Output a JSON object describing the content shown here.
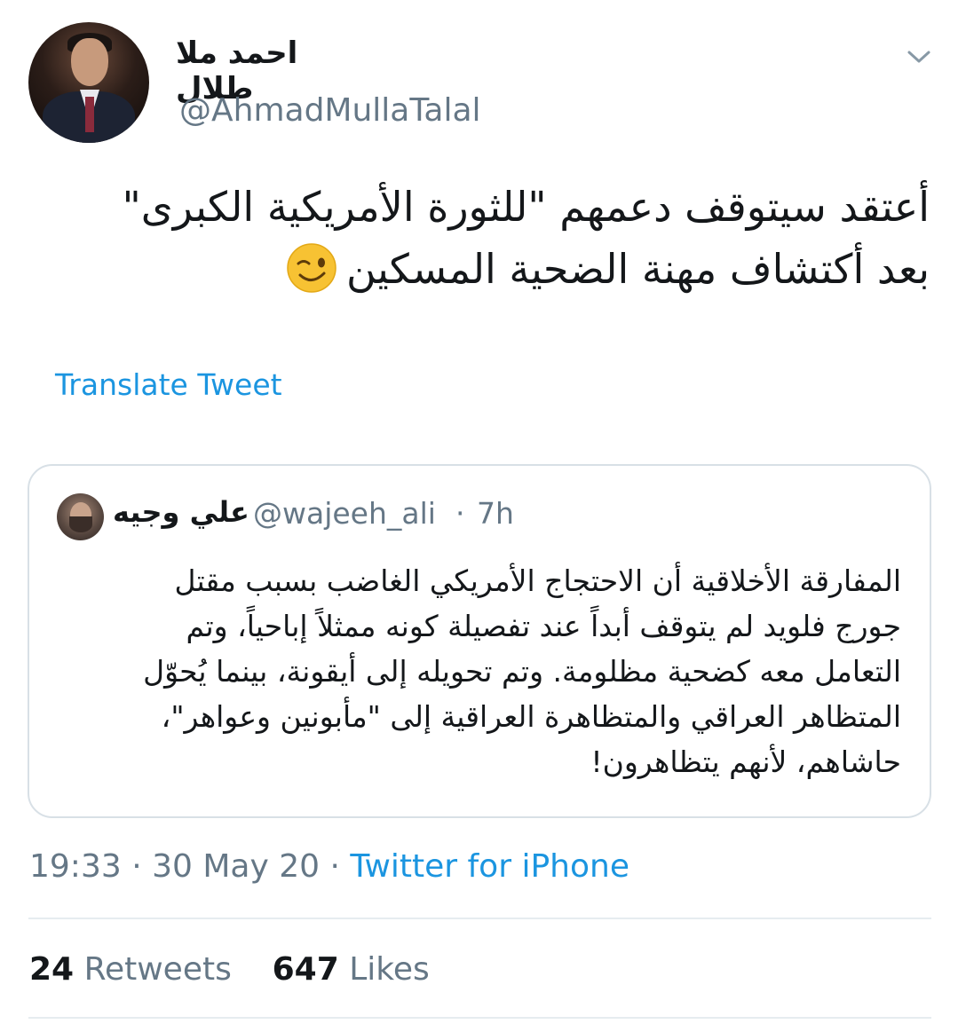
{
  "author": {
    "display_name": "احمد ملا طلال",
    "handle": "@AhmadMullaTalal"
  },
  "tweet": {
    "lines": [
      "أعتقد سيتوقف دعمهم \"للثورة الأمريكية الكبرى\"",
      "بعد أكتشاف مهنة الضحية المسكين"
    ],
    "emoji": "winking-face-icon",
    "translate_label": "Translate Tweet"
  },
  "quoted": {
    "display_name": "علي وجيه",
    "handle": "@wajeeh_ali",
    "separator": "·",
    "time": "7h",
    "lines": [
      "المفارقة الأخلاقية أن الاحتجاج الأمريكي الغاضب بسبب مقتل",
      "جورج فلويد لم يتوقف أبداً عند تفصيلة كونه ممثلاً إباحياً، وتم",
      "التعامل معه كضحية مظلومة. وتم تحويله إلى أيقونة، بينما يُحوّل",
      "المتظاهر العراقي والمتظاهرة العراقية إلى \"مأبونين وعواهر\"،",
      "حاشاهم، لأنهم يتظاهرون!"
    ]
  },
  "meta": {
    "time": "19:33",
    "date": "30 May 20",
    "separator": "·",
    "source": "Twitter for iPhone"
  },
  "stats": {
    "retweets_count": "24",
    "retweets_label": "Retweets",
    "likes_count": "647",
    "likes_label": "Likes"
  },
  "colors": {
    "link": "#1b95e0",
    "secondary_text": "#657786",
    "border": "#d8e0e6"
  }
}
